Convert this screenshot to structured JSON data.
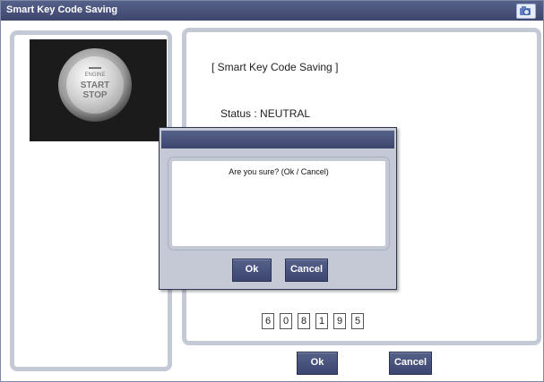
{
  "window": {
    "title": "Smart Key Code Saving",
    "camera_icon": "camera-icon"
  },
  "photo": {
    "engine_label": "ENGINE",
    "start_label": "START",
    "stop_label": "STOP"
  },
  "panel": {
    "heading": "[ Smart Key Code Saving ]",
    "status": "Status : NEUTRAL"
  },
  "code": {
    "digits": [
      "6",
      "0",
      "8",
      "1",
      "9",
      "5"
    ]
  },
  "buttons": {
    "ok": "Ok",
    "cancel": "Cancel"
  },
  "dialog": {
    "title": "",
    "message": "Are you sure? (Ok / Cancel)",
    "ok": "Ok",
    "cancel": "Cancel"
  },
  "colors": {
    "titlebar": "#3d466d",
    "button": "#4a5480",
    "panel_border": "#c4c9d6"
  }
}
